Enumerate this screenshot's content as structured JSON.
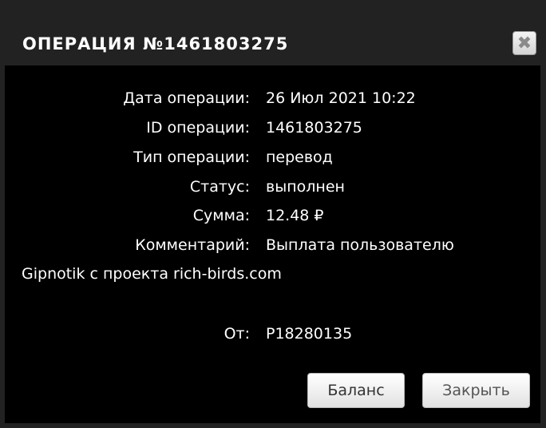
{
  "dialog": {
    "title": "ОПЕРАЦИЯ №1461803275",
    "close_glyph": "✖"
  },
  "details": {
    "date_label": "Дата операции:",
    "date_value": "26 Июл 2021 10:22",
    "id_label": "ID операции:",
    "id_value": "1461803275",
    "type_label": "Тип операции:",
    "type_value": "перевод",
    "status_label": "Статус:",
    "status_value": "выполнен",
    "sum_label": "Сумма:",
    "sum_value": "12.48 ₽",
    "comment_label": "Комментарий:",
    "comment_value": "Выплата пользователю",
    "comment_cont": "Gipnotik с проекта rich-birds.com",
    "from_label": "От:",
    "from_value": "P18280135"
  },
  "buttons": {
    "balance": "Баланс",
    "close": "Закрыть"
  }
}
